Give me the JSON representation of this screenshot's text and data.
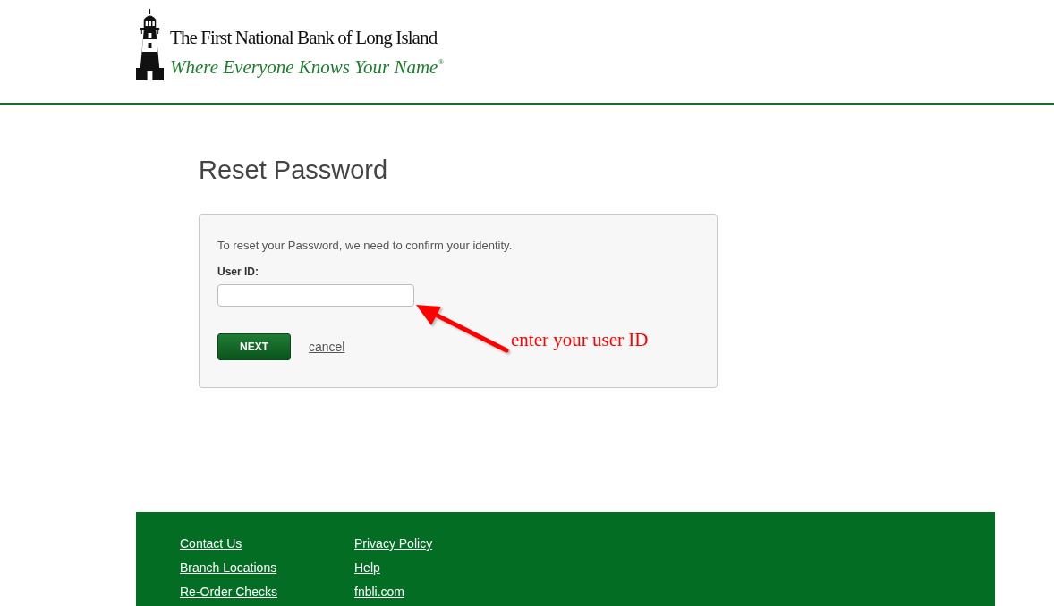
{
  "header": {
    "logo": {
      "name": "The First National Bank of Long Island",
      "tagline": "Where Everyone Knows Your Name$^{®}$"
    }
  },
  "page": {
    "title": "Reset Password"
  },
  "form": {
    "intro": "To reset your Password, we need to confirm your identity.",
    "field": {
      "label": "User ID:"
    },
    "next_button": "NEXT",
    "cancel_link": "cancel"
  },
  "annotation": {
    "text": "enter your user ID"
  },
  "footer": {
    "columns": [
      {
        "links": [
          "Contact Us",
          "Branch Locations",
          "Re-Order Checks"
        ]
      },
      {
        "links": [
          "Privacy Policy",
          "Help",
          "fnbli.com"
        ]
      }
    ]
  }
}
